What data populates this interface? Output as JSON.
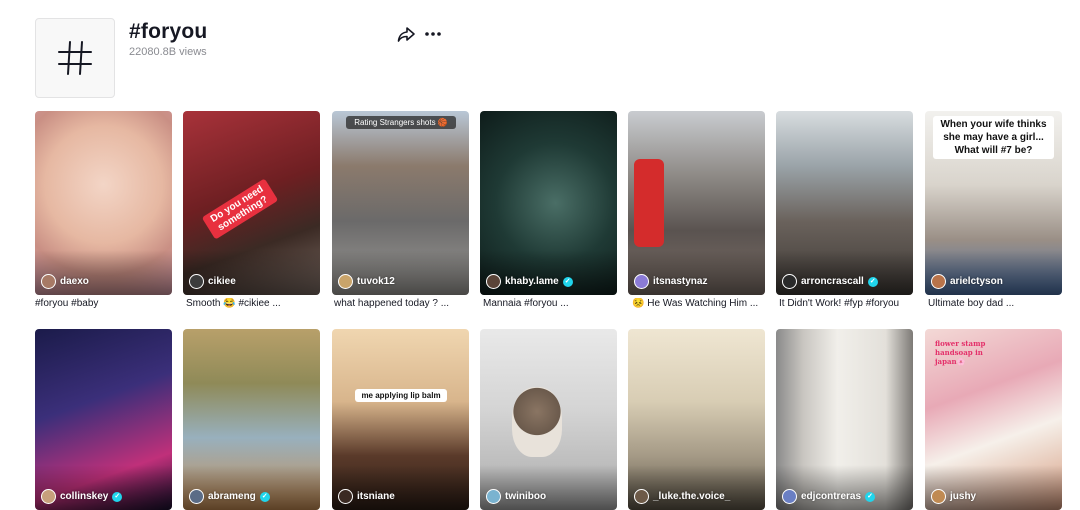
{
  "header": {
    "title": "#foryou",
    "views": "22080.8B views",
    "hashtag_symbol": "#"
  },
  "icons": {
    "share": "share-arrow-icon",
    "more": "more-dots-icon",
    "verified": "verified-check-icon"
  },
  "colors": {
    "verified": "#20d5ec",
    "text": "#161823",
    "muted": "#8a8b91"
  },
  "row1": [
    {
      "user": "daexo",
      "verified": false,
      "caption": "#foryou #baby"
    },
    {
      "user": "cikiee",
      "verified": false,
      "caption": "Smooth 😂 #cikiee ...",
      "overlay": "Do you need something?"
    },
    {
      "user": "tuvok12",
      "verified": false,
      "caption": "what happened today ? ...",
      "overlay": "Rating Strangers shots 🏀"
    },
    {
      "user": "khaby.lame",
      "verified": true,
      "caption": "Mannaia #foryou ..."
    },
    {
      "user": "itsnastynaz",
      "verified": false,
      "caption": "😣 He Was Watching Him ..."
    },
    {
      "user": "arroncrascall",
      "verified": true,
      "caption": "It Didn't Work! #fyp #foryou"
    },
    {
      "user": "arielctyson",
      "verified": false,
      "caption": "Ultimate boy dad ...",
      "overlay": "When your wife thinks she may have a girl... What will #7 be?"
    }
  ],
  "row2": [
    {
      "user": "collinskey",
      "verified": true
    },
    {
      "user": "abrameng",
      "verified": true
    },
    {
      "user": "itsniane",
      "verified": false,
      "overlay": "me applying lip balm"
    },
    {
      "user": "twiniboo",
      "verified": false
    },
    {
      "user": "_luke.the.voice_",
      "verified": false
    },
    {
      "user": "edjcontreras",
      "verified": true
    },
    {
      "user": "jushy",
      "verified": false,
      "overlay": "flower stamp handsoap in japan🌸"
    }
  ]
}
